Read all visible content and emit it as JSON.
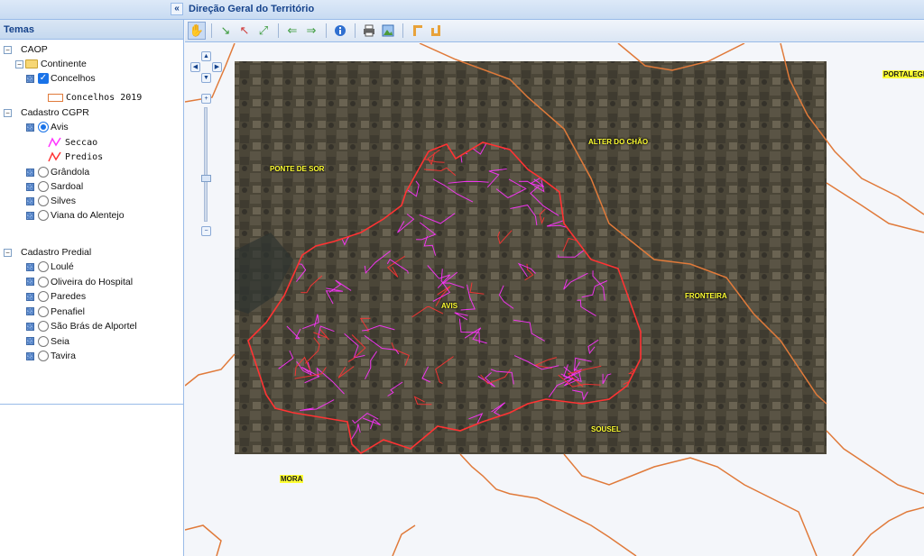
{
  "header": {
    "title": "Direção Geral do Território",
    "collapse_icon": "double-chevron-left-icon"
  },
  "left_panel": {
    "title": "Temas",
    "tree": {
      "caop": {
        "label": "CAOP"
      },
      "continente": {
        "label": "Continente"
      },
      "concelhos": {
        "label": "Concelhos",
        "checked": true
      },
      "concelhos_2019": {
        "label": "Concelhos 2019",
        "swatch_color": "#e07a3a"
      },
      "cadastro_cgpr": {
        "label": "Cadastro CGPR"
      },
      "cgpr_layers": [
        "Avis",
        "Grândola",
        "Sardoal",
        "Silves",
        "Viana do Alentejo"
      ],
      "selected_cgpr": "Avis",
      "legend": [
        {
          "label": "Seccao",
          "color": "#ff33ff"
        },
        {
          "label": "Predios",
          "color": "#ff3333"
        }
      ],
      "cadastro_predial": {
        "label": "Cadastro Predial"
      },
      "predial_layers": [
        "Loulé",
        "Oliveira do Hospital",
        "Paredes",
        "Penafiel",
        "São Brás de Alportel",
        "Seia",
        "Tavira"
      ]
    }
  },
  "toolbar": {
    "tools": [
      "pan-hand-icon",
      "zoom-in-icon",
      "zoom-out-icon",
      "zoom-extent-icon",
      "previous-view-icon",
      "next-view-icon",
      "info-icon",
      "print-icon",
      "export-image-icon",
      "measure-distance-icon",
      "measure-area-icon"
    ]
  },
  "map": {
    "places": [
      {
        "name": "PORTALEGRE"
      },
      {
        "name": "ALTER DO CHÃO"
      },
      {
        "name": "PONTE DE SOR"
      },
      {
        "name": "AVIS"
      },
      {
        "name": "FRONTEIRA"
      },
      {
        "name": "SOUSEL"
      },
      {
        "name": "MORA"
      }
    ],
    "colors": {
      "municipal_boundary": "#e07a3a",
      "section": "#ff33ff",
      "parcel": "#ff3333",
      "imagery": "#4a4538"
    }
  }
}
